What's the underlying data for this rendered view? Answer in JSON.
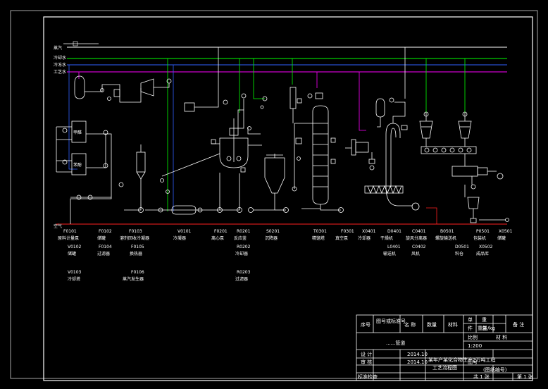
{
  "colors": {
    "background": "#000000",
    "frame": "#ffffff",
    "steam": "#ffffff",
    "cooling_water": "#00ff00",
    "refrigerant": "#3060ff",
    "process_water": "#ff00ff",
    "air": "#ff2020"
  },
  "utility_lines": {
    "steam": "蒸汽",
    "cooling_water": "冷却水",
    "refrigerant": "冷冻水",
    "process_water": "工艺水"
  },
  "air_line_label": "空气",
  "equipment_row_1": [
    {
      "tag": "F0101",
      "name": "原料计量泵"
    },
    {
      "tag": "F0102",
      "name": "储罐"
    },
    {
      "tag": "F0103",
      "name": "溶剂回收冷凝器"
    },
    {
      "tag": "V0101",
      "name": "冷凝器"
    },
    {
      "tag": "F0201",
      "name": "离心泵"
    },
    {
      "tag": "R0201",
      "name": "反应釜"
    },
    {
      "tag": "S0201",
      "name": "沉降器"
    },
    {
      "tag": "T0301",
      "name": "精馏塔"
    },
    {
      "tag": "F0301",
      "name": "真空泵"
    },
    {
      "tag": "X0401",
      "name": "冷却器"
    },
    {
      "tag": "D0401",
      "name": "干燥机"
    },
    {
      "tag": "C0401",
      "name": "旋风分离器"
    },
    {
      "tag": "B0501",
      "name": "螺旋输送机"
    },
    {
      "tag": "P0501",
      "name": "包装机"
    },
    {
      "tag": "X0501",
      "name": "储罐"
    }
  ],
  "equipment_row_2": [
    {
      "tag": "V0102",
      "name": "储罐"
    },
    {
      "tag": "F0104",
      "name": "过滤器"
    },
    {
      "tag": "F0105",
      "name": "换热器"
    },
    {
      "tag": "R0202",
      "name": "冷却器"
    },
    {
      "tag": "L0401",
      "name": "输送机"
    },
    {
      "tag": "C0402",
      "name": "风机"
    },
    {
      "tag": "D0501",
      "name": "料仓"
    },
    {
      "tag": "X0502",
      "name": "成品库"
    }
  ],
  "equipment_row_3": [
    {
      "tag": "V0103",
      "name": "冷却塔"
    },
    {
      "tag": "F0106",
      "name": "蒸汽发生器"
    },
    {
      "tag": "R0203",
      "name": "过滤器"
    }
  ],
  "tank_labels": [
    "甲醛",
    "苯酚"
  ],
  "small_labels": [
    "......管道"
  ],
  "title_block": {
    "row1": [
      "序号",
      "图号或标准号",
      "名 称",
      "数量",
      "材料",
      "单",
      "重",
      "备 注"
    ],
    "row1_sub": [
      "件",
      "总"
    ],
    "weight_unit": "重量/kg",
    "scale_label": "比例",
    "scale_value": "1:200",
    "sheet_label": "共 1 张",
    "sheet_no": "第 1 张",
    "material_label": "材 料",
    "designer_label": "设 计",
    "checker_label": "审 核",
    "approver_label": "标准检查",
    "date_1": "2014.10",
    "date_2": "2014.10",
    "drawing_title_1": "某年产某化合物生产2万吨工程",
    "drawing_title_2": "工艺流程图",
    "drawing_number_label": "图号",
    "drawing_number_value": "(图纸编号)"
  }
}
